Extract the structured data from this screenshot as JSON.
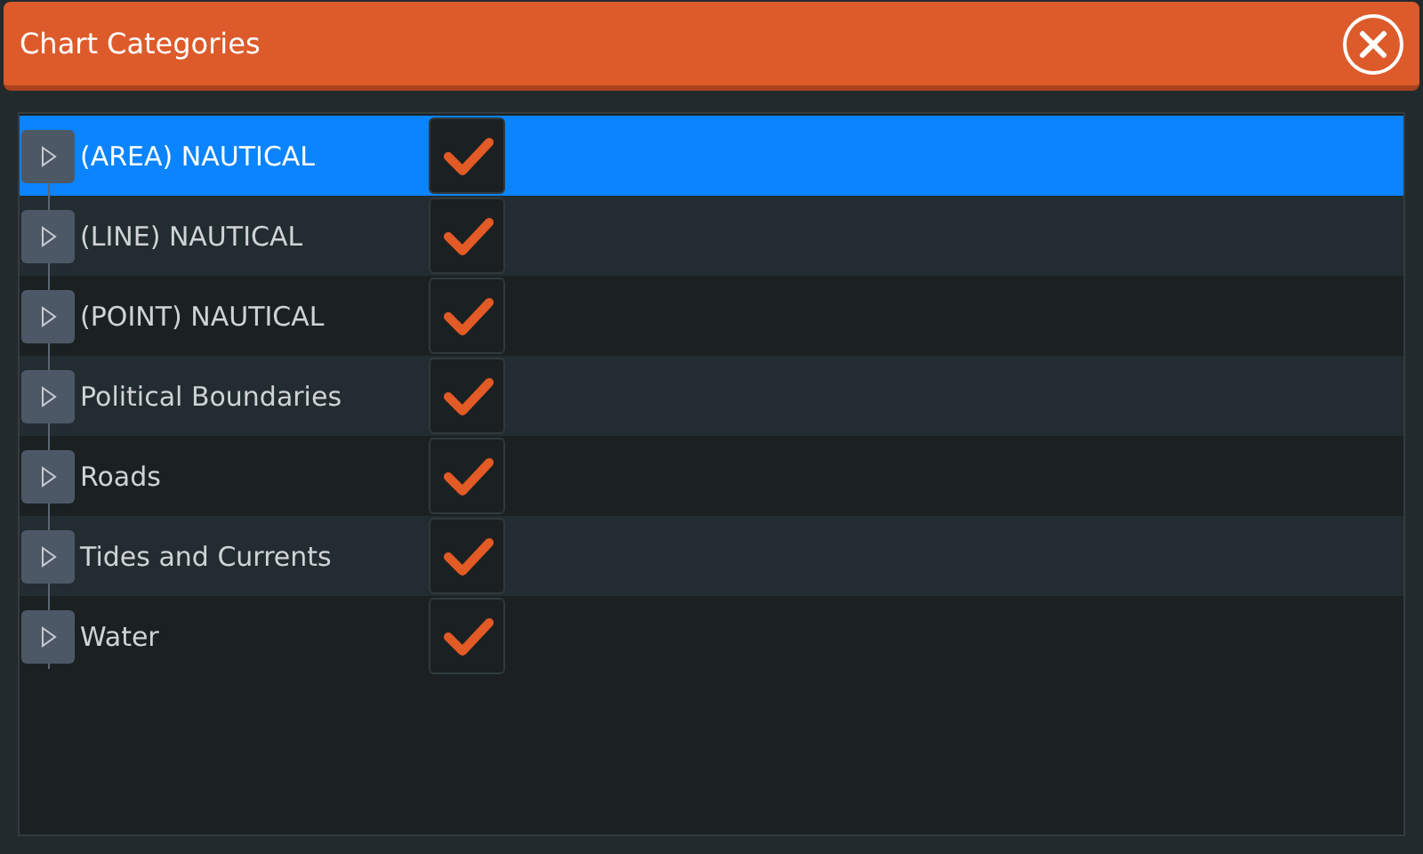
{
  "window": {
    "title": "Chart Categories"
  },
  "categories": [
    {
      "label": "(AREA) NAUTICAL",
      "selected": true,
      "checked": true,
      "expanded": false
    },
    {
      "label": "(LINE) NAUTICAL",
      "selected": false,
      "checked": true,
      "expanded": false
    },
    {
      "label": "(POINT) NAUTICAL",
      "selected": false,
      "checked": true,
      "expanded": false
    },
    {
      "label": "Political Boundaries",
      "selected": false,
      "checked": true,
      "expanded": false
    },
    {
      "label": "Roads",
      "selected": false,
      "checked": true,
      "expanded": false
    },
    {
      "label": "Tides and Currents",
      "selected": false,
      "checked": true,
      "expanded": false
    },
    {
      "label": "Water",
      "selected": false,
      "checked": true,
      "expanded": false
    }
  ]
}
